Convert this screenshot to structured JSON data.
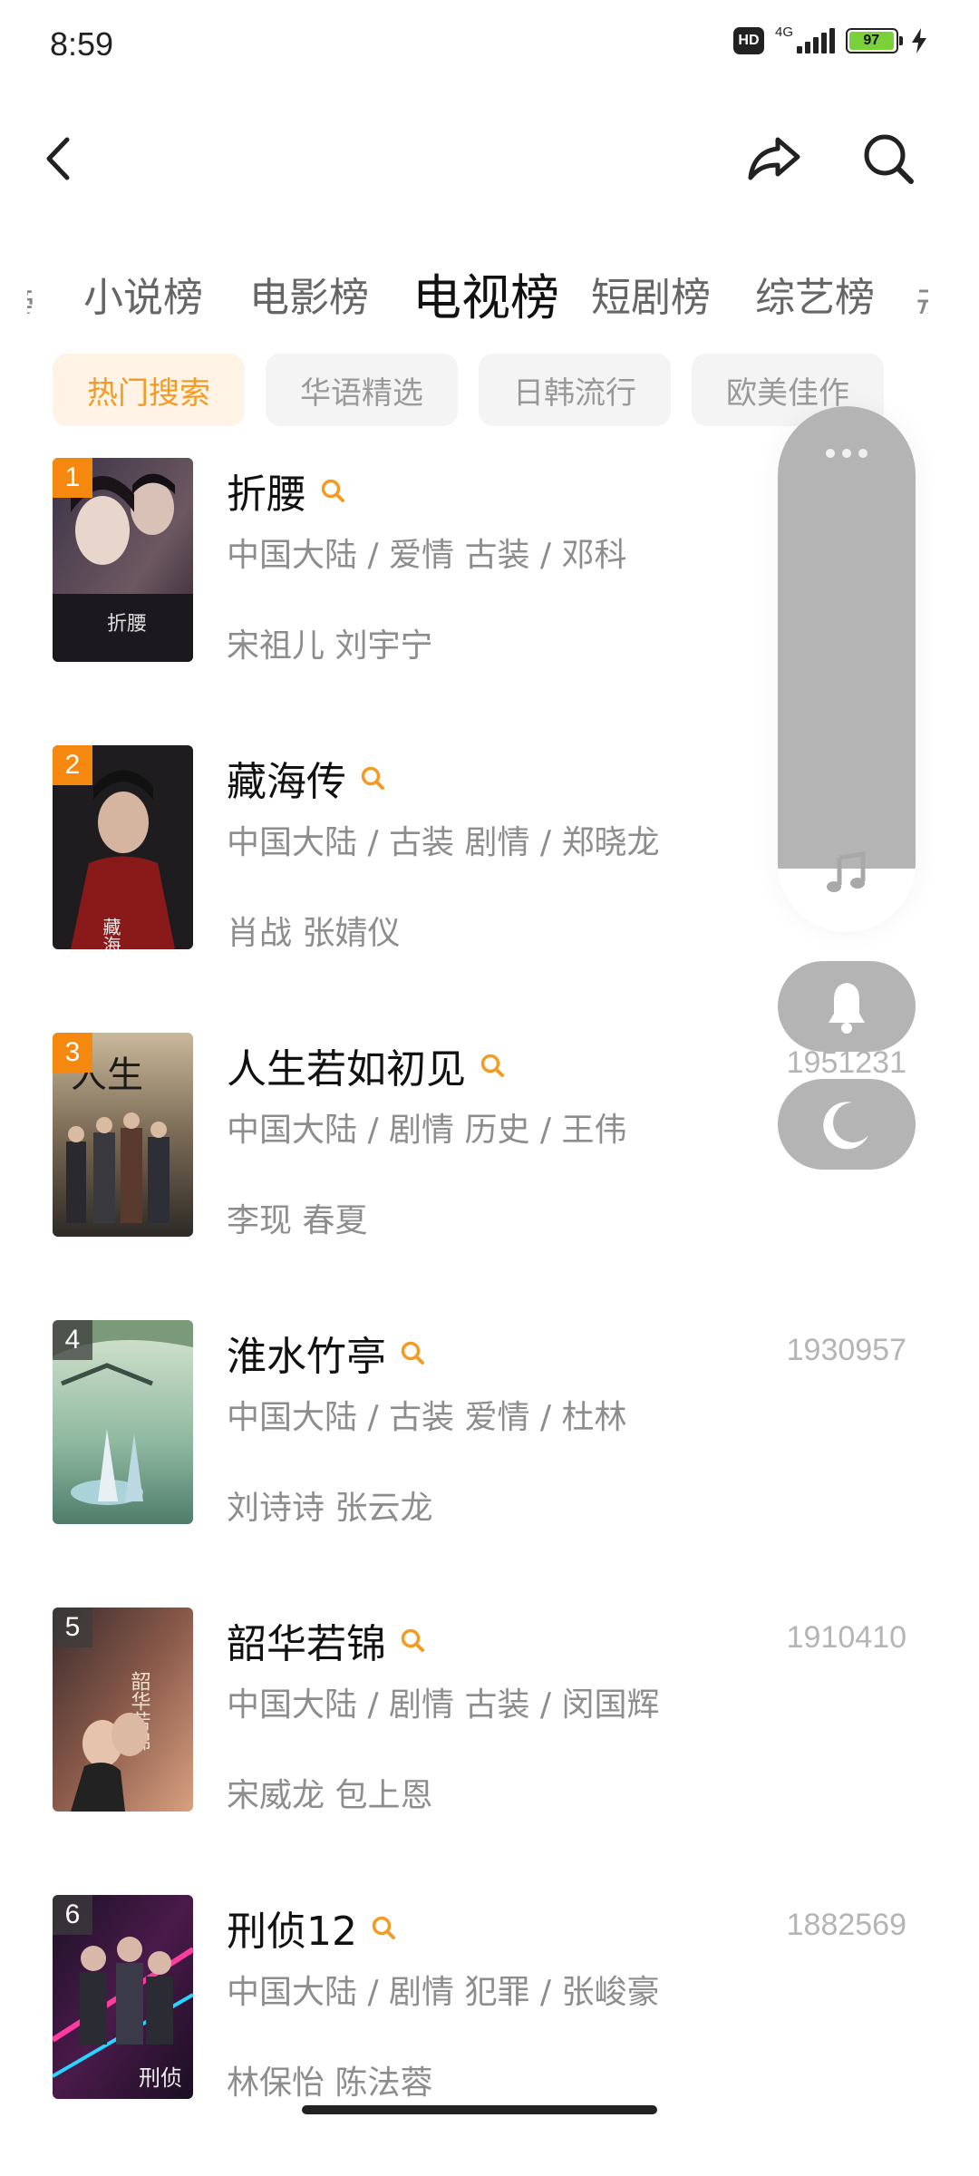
{
  "status_bar": {
    "time": "8:59",
    "hd_label": "HD",
    "network_label": "4G",
    "battery_percent": "97",
    "battery_level": 0.97
  },
  "top_nav": {
    "back_icon": "chevron-left-icon",
    "share_icon": "share-arrow-icon",
    "search_icon": "search-icon"
  },
  "category_tabs": [
    {
      "label": "小说榜",
      "active": false
    },
    {
      "label": "电影榜",
      "active": false
    },
    {
      "label": "电视榜",
      "active": true
    },
    {
      "label": "短剧榜",
      "active": false
    },
    {
      "label": "综艺榜",
      "active": false
    }
  ],
  "sub_tabs": [
    {
      "label": "热门搜索",
      "active": true
    },
    {
      "label": "华语精选",
      "active": false
    },
    {
      "label": "日韩流行",
      "active": false
    },
    {
      "label": "欧美佳作",
      "active": false
    }
  ],
  "list": [
    {
      "rank": "1",
      "title": "折腰",
      "meta": "中国大陆 / 爱情 古装 / 邓科",
      "cast": "宋祖儿 刘宇宁",
      "score": ""
    },
    {
      "rank": "2",
      "title": "藏海传",
      "meta": "中国大陆 / 古装 剧情 / 郑晓龙",
      "cast": "肖战 张婧仪",
      "score": ""
    },
    {
      "rank": "3",
      "title": "人生若如初见",
      "meta": "中国大陆 / 剧情 历史 / 王伟",
      "cast": "李现 春夏",
      "score": "1951231"
    },
    {
      "rank": "4",
      "title": "淮水竹亭",
      "meta": "中国大陆 / 古装 爱情 / 杜林",
      "cast": "刘诗诗 张云龙",
      "score": "1930957"
    },
    {
      "rank": "5",
      "title": "韶华若锦",
      "meta": "中国大陆 / 剧情 古装 / 闵国辉",
      "cast": "宋威龙 包上恩",
      "score": "1910410"
    },
    {
      "rank": "6",
      "title": "刑侦12",
      "meta": "中国大陆 / 剧情 犯罪 / 张峻豪",
      "cast": "林保怡 陈法蓉",
      "score": "1882569"
    }
  ],
  "floating_panel": {
    "more_icon": "more-dots-icon",
    "music_icon": "music-note-icon",
    "bell_icon": "bell-icon",
    "moon_icon": "moon-icon"
  },
  "colors": {
    "accent": "#f59a23",
    "rank_top": "#f5890f",
    "panel_gray": "#b4b4b4",
    "meta_gray": "#8d8d8d"
  }
}
